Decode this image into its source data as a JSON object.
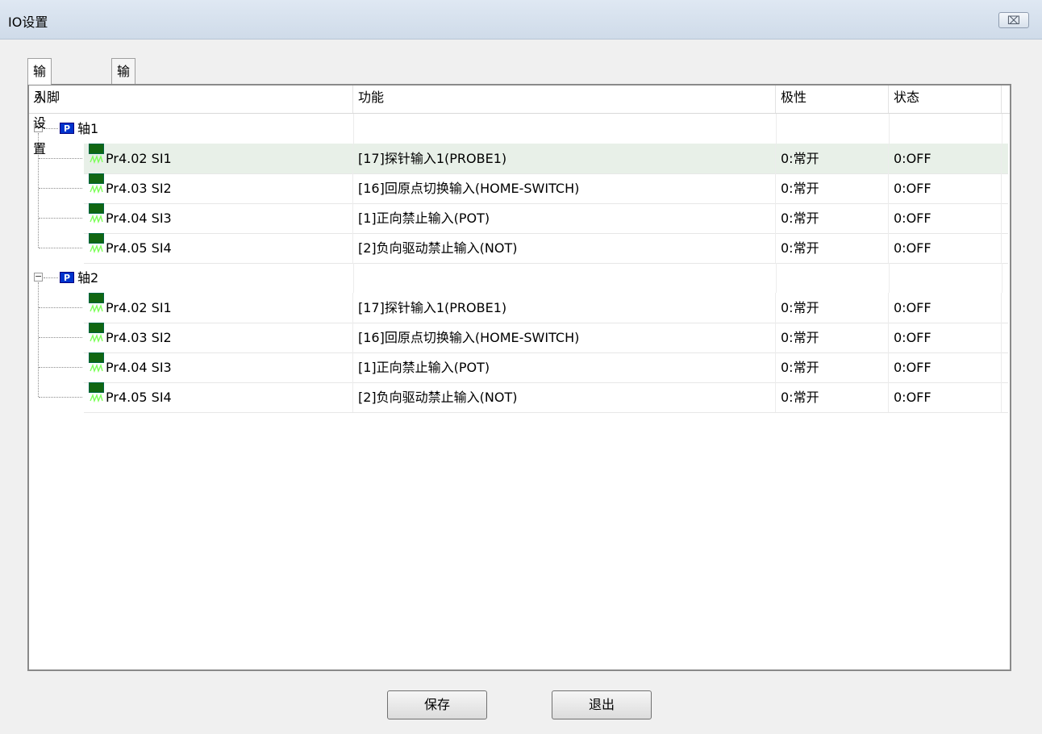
{
  "window": {
    "title": "IO设置",
    "close_label": "⌧"
  },
  "tabs": [
    {
      "label": "输入设置",
      "active": true
    },
    {
      "label": "输出设置",
      "active": false
    }
  ],
  "columns": {
    "pin": "引脚",
    "function": "功能",
    "polarity": "极性",
    "status": "状态"
  },
  "groups": [
    {
      "name": "轴1",
      "rows": [
        {
          "pin": "Pr4.02 SI1",
          "function": "[17]探针输入1(PROBE1)",
          "polarity": "0:常开",
          "status": "0:OFF",
          "selected": true
        },
        {
          "pin": "Pr4.03 SI2",
          "function": "[16]回原点切换输入(HOME-SWITCH)",
          "polarity": "0:常开",
          "status": "0:OFF"
        },
        {
          "pin": "Pr4.04 SI3",
          "function": "[1]正向禁止输入(POT)",
          "polarity": "0:常开",
          "status": "0:OFF"
        },
        {
          "pin": "Pr4.05 SI4",
          "function": "[2]负向驱动禁止输入(NOT)",
          "polarity": "0:常开",
          "status": "0:OFF"
        }
      ]
    },
    {
      "name": "轴2",
      "rows": [
        {
          "pin": "Pr4.02 SI1",
          "function": "[17]探针输入1(PROBE1)",
          "polarity": "0:常开",
          "status": "0:OFF"
        },
        {
          "pin": "Pr4.03 SI2",
          "function": "[16]回原点切换输入(HOME-SWITCH)",
          "polarity": "0:常开",
          "status": "0:OFF"
        },
        {
          "pin": "Pr4.04 SI3",
          "function": "[1]正向禁止输入(POT)",
          "polarity": "0:常开",
          "status": "0:OFF"
        },
        {
          "pin": "Pr4.05 SI4",
          "function": "[2]负向驱动禁止输入(NOT)",
          "polarity": "0:常开",
          "status": "0:OFF"
        }
      ]
    }
  ],
  "badge_label": "P",
  "buttons": {
    "save": "保存",
    "exit": "退出"
  }
}
